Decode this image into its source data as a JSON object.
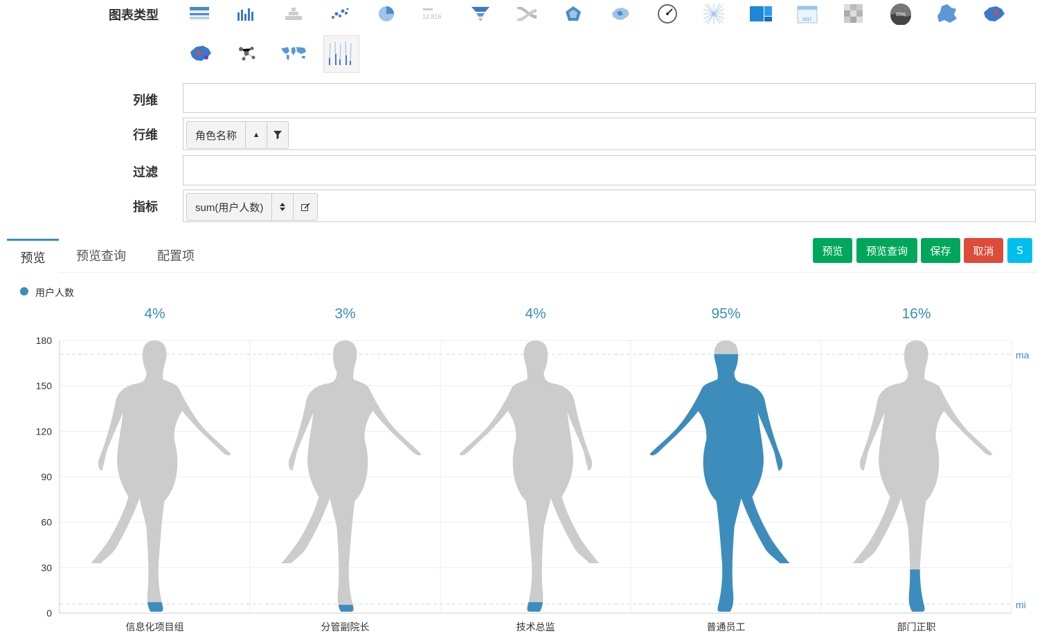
{
  "form": {
    "chart_type_label": "图表类型",
    "col_dim_label": "列维",
    "row_dim_label": "行维",
    "filter_label": "过滤",
    "metric_label": "指标",
    "row_pill": "角色名称",
    "metric_pill": "sum(用户人数)"
  },
  "icons": [
    "table-icon",
    "bar-chart-icon",
    "pyramid-icon",
    "scatter-icon",
    "pie-chart-icon",
    "number-icon",
    "funnel-icon",
    "sankey-icon",
    "radar-icon",
    "china-map-icon",
    "gauge-icon",
    "graph-icon",
    "treemap-icon",
    "calendar-icon",
    "heatmap-icon",
    "liquid-fill-icon",
    "province-map-icon",
    "china-map-pin-icon",
    "china-map-scatter-icon",
    "molecule-icon",
    "world-map-icon",
    "pictorial-bar-icon"
  ],
  "icon_text": {
    "number": "12,816",
    "calendar": "2017",
    "liquid": "65%"
  },
  "tabs": [
    "预览",
    "预览查询",
    "配置项"
  ],
  "actions": {
    "preview": "预览",
    "preview_query": "预览查询",
    "save": "保存",
    "cancel": "取消",
    "s": "S"
  },
  "colors": {
    "primary": "#3c8dbc",
    "green": "#00a65a",
    "red": "#dd4b39",
    "cyan": "#00c0ef",
    "grey": "#cccccc"
  },
  "chart_data": {
    "type": "pictorial-bar",
    "legend": [
      "用户人数"
    ],
    "categories": [
      "信息化项目组",
      "分管副院长",
      "技术总监",
      "普通员工",
      "部门正职"
    ],
    "values": [
      4,
      3,
      4,
      95,
      16
    ],
    "percent_labels": [
      "4%",
      "3%",
      "4%",
      "95%",
      "16%"
    ],
    "ylim": [
      0,
      180
    ],
    "yticks": [
      "0",
      "30",
      "60",
      "90",
      "120",
      "150",
      "180"
    ],
    "markline_labels": [
      "ma",
      "mi"
    ]
  }
}
